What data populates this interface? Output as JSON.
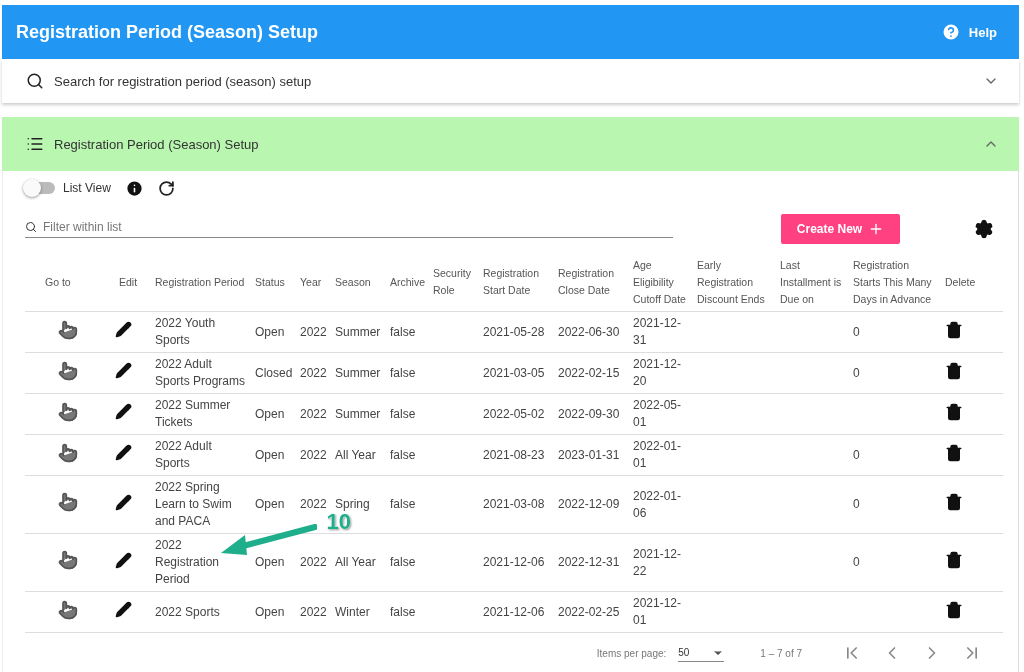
{
  "header": {
    "title": "Registration Period (Season) Setup",
    "help": "Help"
  },
  "search_panel": {
    "title": "Search for registration period (season) setup",
    "expanded": false
  },
  "list_panel": {
    "title": "Registration Period (Season) Setup",
    "expanded": true
  },
  "list_view_toggle": {
    "label": "List View",
    "on": false
  },
  "filter": {
    "placeholder": "Filter within list"
  },
  "create_button": "Create New",
  "table": {
    "columns": [
      "Go to",
      "Edit",
      "Registration Period",
      "Status",
      "Year",
      "Season",
      "Archive",
      "Security Role",
      "Registration Start Date",
      "Registration Close Date",
      "Age Eligibility Cutoff Date",
      "Early Registration Discount Ends",
      "Last Installment is Due on",
      "Registration Starts This Many Days in Advance",
      "Delete"
    ],
    "rows": [
      {
        "period": "2022 Youth Sports",
        "status": "Open",
        "year": "2022",
        "season": "Summer",
        "archive": "false",
        "start": "2021-05-28",
        "close": "2022-06-30",
        "cutoff": "2021-12-31",
        "days": "0"
      },
      {
        "period": "2022 Adult Sports Programs",
        "status": "Closed",
        "year": "2022",
        "season": "Summer",
        "archive": "false",
        "start": "2021-03-05",
        "close": "2022-02-15",
        "cutoff": "2021-12-20",
        "days": "0"
      },
      {
        "period": "2022 Summer Tickets",
        "status": "Open",
        "year": "2022",
        "season": "Summer",
        "archive": "false",
        "start": "2022-05-02",
        "close": "2022-09-30",
        "cutoff": "2022-05-01"
      },
      {
        "period": "2022 Adult Sports",
        "status": "Open",
        "year": "2022",
        "season": "All Year",
        "archive": "false",
        "start": "2021-08-23",
        "close": "2023-01-31",
        "cutoff": "2022-01-01",
        "days": "0"
      },
      {
        "period": "2022 Spring Learn to Swim and PACA",
        "status": "Open",
        "year": "2022",
        "season": "Spring",
        "archive": "false",
        "start": "2021-03-08",
        "close": "2022-12-09",
        "cutoff": "2022-01-06",
        "days": "0"
      },
      {
        "period": "2022 Registration Period",
        "status": "Open",
        "year": "2022",
        "season": "All Year",
        "archive": "false",
        "start": "2021-12-06",
        "close": "2022-12-31",
        "cutoff": "2021-12-22",
        "days": "0"
      },
      {
        "period": "2022 Sports",
        "status": "Open",
        "year": "2022",
        "season": "Winter",
        "archive": "false",
        "start": "2021-12-06",
        "close": "2022-02-25",
        "cutoff": "2021-12-01"
      }
    ]
  },
  "callout": {
    "number": "10"
  },
  "paginator": {
    "items_per_page_label": "Items per page:",
    "items_per_page": "50",
    "range": "1 – 7 of 7"
  }
}
